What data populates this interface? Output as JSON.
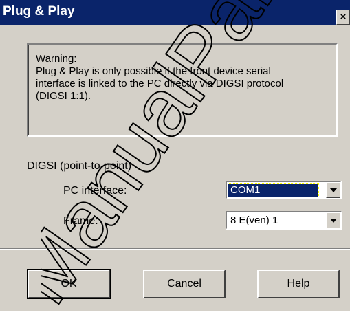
{
  "dialog": {
    "title": "Plug & Play",
    "close_label": "×"
  },
  "warning": {
    "line1": "Warning:",
    "line2": "Plug & Play is only possible if the front device serial",
    "line3": "interface is linked to the PC directly via DIGSI protocol",
    "line4": "(DIGSI 1:1)."
  },
  "group": {
    "label": "DIGSI (point-to-point)"
  },
  "pc_interface": {
    "label_pre": "P",
    "label_mnemonic": "C",
    "label_post": " interface:",
    "value": "COM1"
  },
  "frame": {
    "label_mnemonic": "F",
    "label_post": "rame:",
    "value": "8 E(ven) 1"
  },
  "buttons": {
    "ok": "OK",
    "cancel": "Cancel",
    "help": "Help"
  },
  "watermark": {
    "text": "ManualPartM"
  }
}
